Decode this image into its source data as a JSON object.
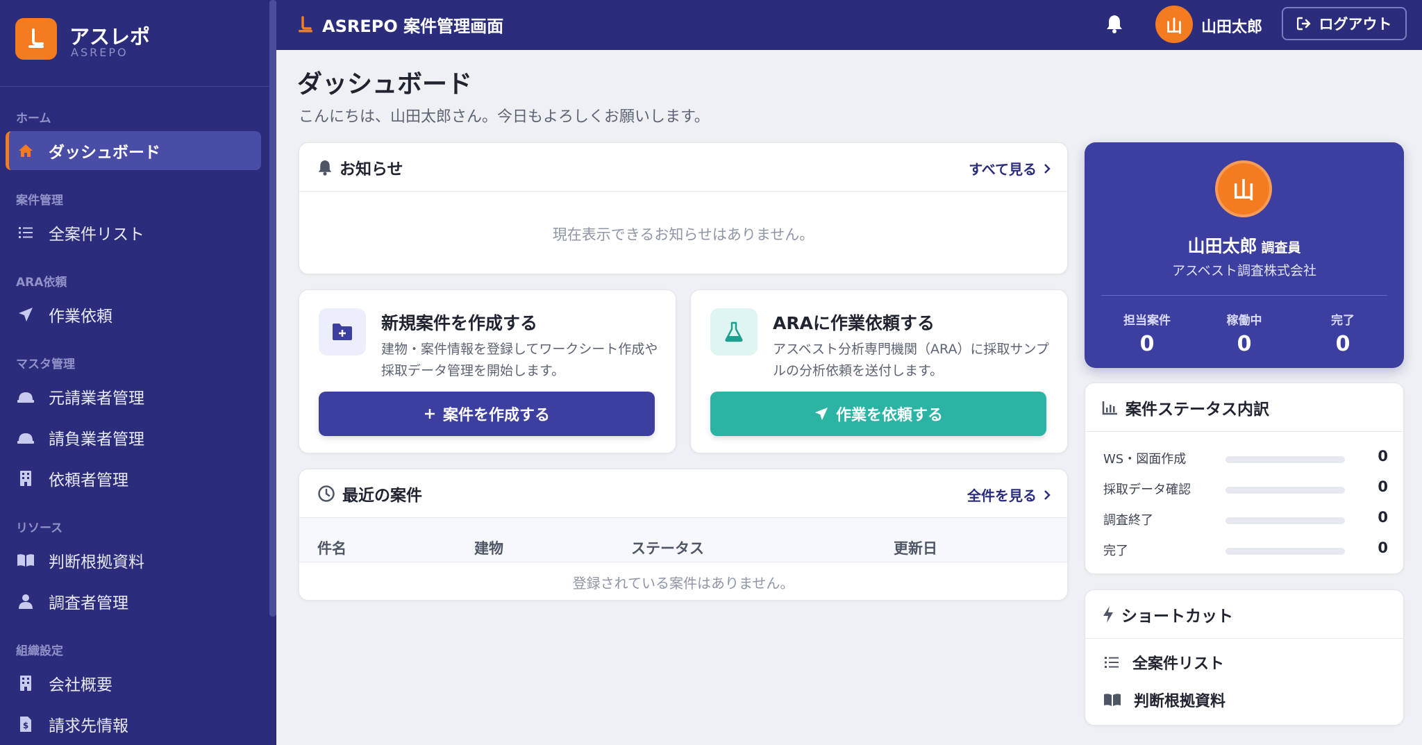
{
  "brand": {
    "name": "アスレポ",
    "sub": "ASREPO"
  },
  "topbar": {
    "title": "ASREPO 案件管理画面",
    "user_initial": "山",
    "user_name": "山田太郎",
    "logout_label": "ログアウト"
  },
  "sidebar": {
    "sections": [
      {
        "label": "ホーム",
        "items": [
          {
            "label": "ダッシュボード",
            "icon": "home-icon",
            "active": true
          }
        ]
      },
      {
        "label": "案件管理",
        "items": [
          {
            "label": "全案件リスト",
            "icon": "list-icon"
          }
        ]
      },
      {
        "label": "ARA依頼",
        "items": [
          {
            "label": "作業依頼",
            "icon": "send-icon"
          }
        ]
      },
      {
        "label": "マスタ管理",
        "items": [
          {
            "label": "元請業者管理",
            "icon": "helmet-icon"
          },
          {
            "label": "請負業者管理",
            "icon": "helmet-icon"
          },
          {
            "label": "依頼者管理",
            "icon": "building-icon"
          }
        ]
      },
      {
        "label": "リソース",
        "items": [
          {
            "label": "判断根拠資料",
            "icon": "book-icon"
          },
          {
            "label": "調査者管理",
            "icon": "user-icon"
          }
        ]
      },
      {
        "label": "組織設定",
        "items": [
          {
            "label": "会社概要",
            "icon": "building-icon"
          },
          {
            "label": "請求先情報",
            "icon": "invoice-icon"
          }
        ]
      }
    ]
  },
  "page": {
    "title": "ダッシュボード",
    "subtitle": "こんにちは、山田太郎さん。今日もよろしくお願いします。"
  },
  "notices": {
    "title": "お知らせ",
    "more": "すべて見る",
    "empty": "現在表示できるお知らせはありません。"
  },
  "actions": {
    "create": {
      "title": "新規案件を作成する",
      "desc": "建物・案件情報を登録してワークシート作成や採取データ管理を開始します。",
      "button": "案件を作成する"
    },
    "ara": {
      "title": "ARAに作業依頼する",
      "desc": "アスベスト分析専門機関（ARA）に採取サンプルの分析依頼を送付します。",
      "button": "作業を依頼する"
    }
  },
  "recent": {
    "title": "最近の案件",
    "more": "全件を見る",
    "columns": [
      "件名",
      "建物",
      "ステータス",
      "更新日"
    ],
    "empty": "登録されている案件はありません。"
  },
  "profile": {
    "initial": "山",
    "name": "山田太郎",
    "role": "調査員",
    "company": "アスベスト調査株式会社",
    "stats": [
      {
        "label": "担当案件",
        "value": "0"
      },
      {
        "label": "稼働中",
        "value": "0"
      },
      {
        "label": "完了",
        "value": "0"
      }
    ]
  },
  "status_breakdown": {
    "title": "案件ステータス内訳",
    "rows": [
      {
        "label": "WS・図面作成",
        "value": "0",
        "fraction": 0
      },
      {
        "label": "採取データ確認",
        "value": "0",
        "fraction": 0
      },
      {
        "label": "調査終了",
        "value": "0",
        "fraction": 0
      },
      {
        "label": "完了",
        "value": "0",
        "fraction": 0
      }
    ]
  },
  "shortcuts": {
    "title": "ショートカット",
    "items": [
      {
        "label": "全案件リスト",
        "icon": "list-icon"
      },
      {
        "label": "判断根拠資料",
        "icon": "book-icon"
      }
    ]
  },
  "colors": {
    "primary": "#2b2d7c",
    "accent": "#f47b20",
    "teal": "#2bb3a3",
    "indigo_button": "#3d3fa0"
  }
}
